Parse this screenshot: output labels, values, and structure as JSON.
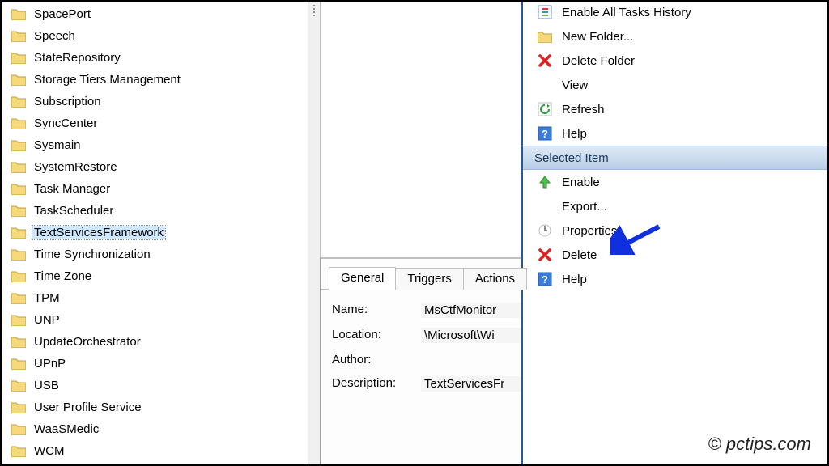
{
  "tree": {
    "items": [
      {
        "label": "SpacePort"
      },
      {
        "label": "Speech"
      },
      {
        "label": "StateRepository"
      },
      {
        "label": "Storage Tiers Management"
      },
      {
        "label": "Subscription"
      },
      {
        "label": "SyncCenter"
      },
      {
        "label": "Sysmain"
      },
      {
        "label": "SystemRestore"
      },
      {
        "label": "Task Manager"
      },
      {
        "label": "TaskScheduler"
      },
      {
        "label": "TextServicesFramework",
        "selected": true
      },
      {
        "label": "Time Synchronization"
      },
      {
        "label": "Time Zone"
      },
      {
        "label": "TPM"
      },
      {
        "label": "UNP"
      },
      {
        "label": "UpdateOrchestrator"
      },
      {
        "label": "UPnP"
      },
      {
        "label": "USB"
      },
      {
        "label": "User Profile Service"
      },
      {
        "label": "WaaSMedic"
      },
      {
        "label": "WCM"
      }
    ]
  },
  "details": {
    "tabs": {
      "general": "General",
      "triggers": "Triggers",
      "actions": "Actions"
    },
    "labels": {
      "name": "Name:",
      "location": "Location:",
      "author": "Author:",
      "description": "Description:"
    },
    "values": {
      "name": "MsCtfMonitor",
      "location": "\\Microsoft\\Wi",
      "author": "",
      "description": "TextServicesFr"
    }
  },
  "actions": {
    "enable_history": "Enable All Tasks History",
    "new_folder": "New Folder...",
    "delete_folder": "Delete Folder",
    "view": "View",
    "refresh": "Refresh",
    "help": "Help",
    "section_selected": "Selected Item",
    "enable": "Enable",
    "export": "Export...",
    "properties": "Properties",
    "delete": "Delete",
    "help2": "Help"
  },
  "watermark": "© pctips.com"
}
